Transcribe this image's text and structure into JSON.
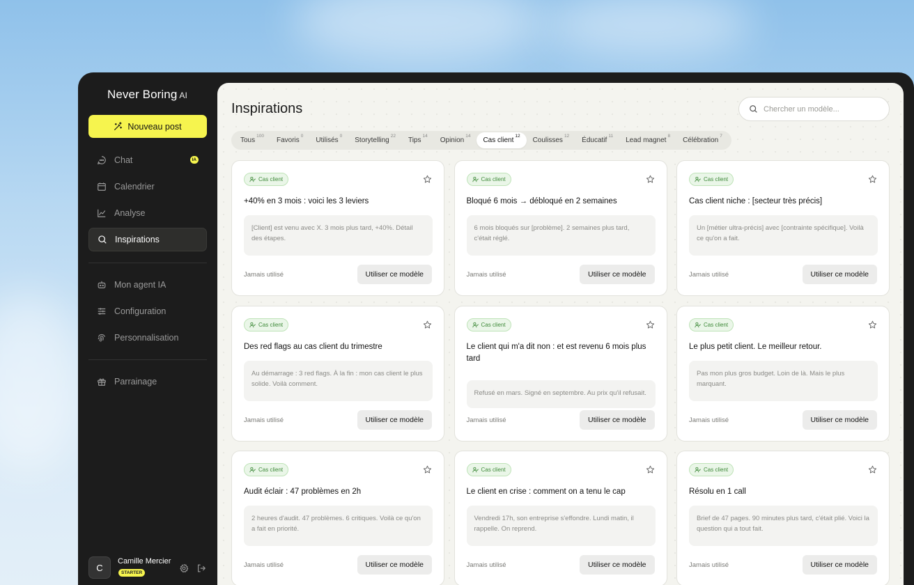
{
  "app": {
    "brand": "Never Boring",
    "brand_suffix": "AI"
  },
  "sidebar": {
    "new_post": "Nouveau post",
    "items": [
      {
        "label": "Chat",
        "icon": "chat-icon",
        "badge": "IA"
      },
      {
        "label": "Calendrier",
        "icon": "calendar-icon"
      },
      {
        "label": "Analyse",
        "icon": "chart-icon"
      },
      {
        "label": "Inspirations",
        "icon": "search-icon",
        "active": true
      },
      {
        "label": "Mon agent IA",
        "icon": "bot-icon"
      },
      {
        "label": "Configuration",
        "icon": "sliders-icon"
      },
      {
        "label": "Personnalisation",
        "icon": "fingerprint-icon"
      },
      {
        "label": "Parrainage",
        "icon": "gift-icon"
      }
    ]
  },
  "user": {
    "initial": "C",
    "name": "Camille Mercier",
    "plan": "STARTER"
  },
  "main": {
    "title": "Inspirations",
    "search_placeholder": "Chercher un modèle...",
    "tabs": [
      {
        "label": "Tous",
        "count": "100"
      },
      {
        "label": "Favoris",
        "count": "0"
      },
      {
        "label": "Utilisés",
        "count": "0"
      },
      {
        "label": "Storytelling",
        "count": "22"
      },
      {
        "label": "Tips",
        "count": "14"
      },
      {
        "label": "Opinion",
        "count": "14"
      },
      {
        "label": "Cas client",
        "count": "12",
        "active": true
      },
      {
        "label": "Coulisses",
        "count": "12"
      },
      {
        "label": "Éducatif",
        "count": "11"
      },
      {
        "label": "Lead magnet",
        "count": "8"
      },
      {
        "label": "Célébration",
        "count": "7"
      }
    ],
    "card_tag": "Cas client",
    "card_used": "Jamais utilisé",
    "card_button": "Utiliser ce modèle",
    "cards": [
      {
        "title": "+40% en 3 mois : voici les 3 leviers",
        "excerpt": "[Client] est venu avec X. 3 mois plus tard, +40%. Détail des étapes."
      },
      {
        "title": "Bloqué 6 mois → débloqué en 2 semaines",
        "excerpt": "6 mois bloqués sur [problème]. 2 semaines plus tard, c'était réglé."
      },
      {
        "title": "Cas client niche : [secteur très précis]",
        "excerpt": "Un [métier ultra-précis] avec [contrainte spécifique]. Voilà ce qu'on a fait."
      },
      {
        "title": "Des red flags au cas client du trimestre",
        "excerpt": "Au démarrage : 3 red flags. À la fin : mon cas client le plus solide. Voilà comment."
      },
      {
        "title": "Le client qui m'a dit non : et est revenu 6 mois plus tard",
        "excerpt": "Refusé en mars. Signé en septembre. Au prix qu'il refusait."
      },
      {
        "title": "Le plus petit client. Le meilleur retour.",
        "excerpt": "Pas mon plus gros budget. Loin de là. Mais le plus marquant."
      },
      {
        "title": "Audit éclair : 47 problèmes en 2h",
        "excerpt": "2 heures d'audit. 47 problèmes. 6 critiques. Voilà ce qu'on a fait en priorité."
      },
      {
        "title": "Le client en crise : comment on a tenu le cap",
        "excerpt": "Vendredi 17h, son entreprise s'effondre. Lundi matin, il rappelle. On reprend."
      },
      {
        "title": "Résolu en 1 call",
        "excerpt": "Brief de 47 pages. 90 minutes plus tard, c'était plié. Voici la question qui a tout fait."
      }
    ]
  }
}
